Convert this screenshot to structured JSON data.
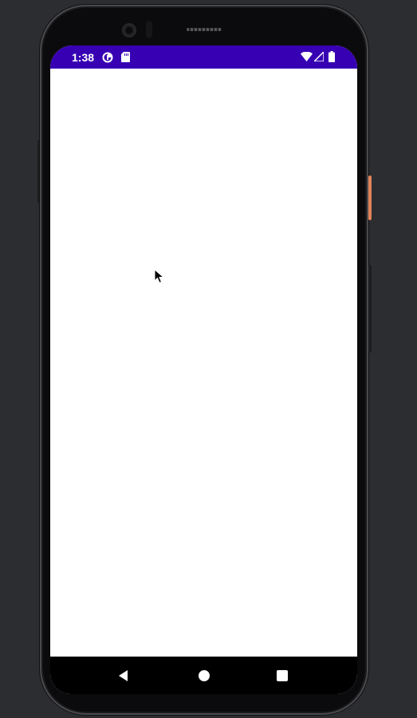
{
  "status_bar": {
    "time": "1:38",
    "background_color": "#3700b3",
    "left_icons": [
      "data-saver-icon",
      "sd-card-icon"
    ],
    "right_icons": [
      "wifi-icon",
      "cellular-signal-icon",
      "battery-icon"
    ]
  },
  "navigation_bar": {
    "buttons": [
      "back-icon",
      "home-icon",
      "recents-icon"
    ]
  },
  "content": {
    "background_color": "#ffffff"
  },
  "device": {
    "frame_color": "#0b0b0d",
    "power_button_color": "#e0835a"
  }
}
